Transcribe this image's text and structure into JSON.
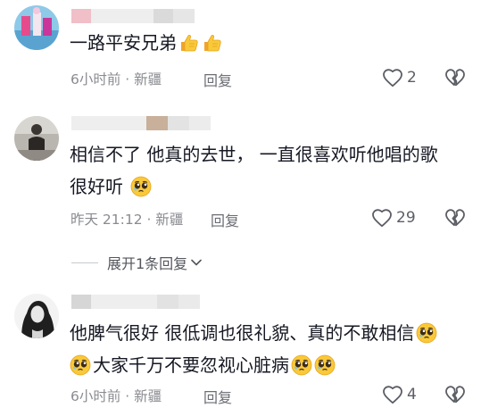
{
  "comments": [
    {
      "text_lines": [
        "一路平安兄弟"
      ],
      "emoji_after": [
        "thumbs-up",
        "thumbs-up"
      ],
      "time": "6小时前",
      "location": "新疆",
      "reply_label": "回复",
      "likes": "2"
    },
    {
      "text_lines": [
        "相信不了 他真的去世， 一直很喜欢听他唱的歌",
        "很好听"
      ],
      "emoji_after": [
        "pleading-face"
      ],
      "time": "昨天 21:12",
      "location": "新疆",
      "reply_label": "回复",
      "likes": "29"
    },
    {
      "text_lines": [
        "他脾气很好 很低调也很礼貌、真的不敢相信",
        "大家千万不要忽视心脏病"
      ],
      "emoji_after": [
        "pleading-face",
        "pleading-face",
        "pleading-face"
      ],
      "time": "6小时前",
      "location": "新疆",
      "reply_label": "回复",
      "likes": "4"
    }
  ],
  "expand_replies": {
    "label": "展开1条回复"
  },
  "meta_separator": " · ",
  "colors": {
    "text": "#161823",
    "meta": "#8a8b91",
    "emoji_yellow": "#f9c93a",
    "icon": "#5c5e66"
  },
  "icons": [
    "heart-outline-icon",
    "broken-heart-icon",
    "chevron-down-icon",
    "thumbs-up-emoji-icon",
    "pleading-face-emoji-icon"
  ]
}
